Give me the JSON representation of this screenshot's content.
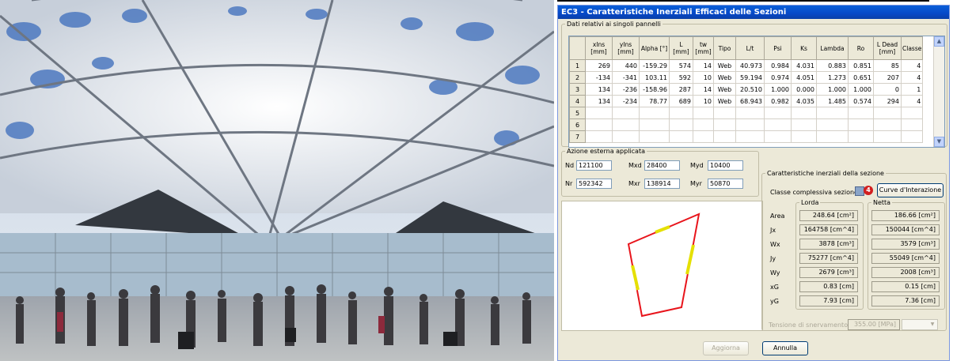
{
  "window": {
    "title": "EC3 - Caratteristiche Inerziali Efficaci delle Sezioni"
  },
  "panels_group": {
    "legend": "Dati relativi ai singoli pannelli",
    "columns": [
      "",
      "xIns [mm]",
      "yIns [mm]",
      "Alpha [°]",
      "L [mm]",
      "tw [mm]",
      "Tipo",
      "L/t",
      "Psi",
      "Ks",
      "Lambda",
      "Ro",
      "L Dead [mm]",
      "Classe"
    ],
    "rows": [
      [
        "1",
        "269",
        "440",
        "-159.29",
        "574",
        "14",
        "Web",
        "40.973",
        "0.984",
        "4.031",
        "0.883",
        "0.851",
        "85",
        "4"
      ],
      [
        "2",
        "-134",
        "-341",
        "103.11",
        "592",
        "10",
        "Web",
        "59.194",
        "0.974",
        "4.051",
        "1.273",
        "0.651",
        "207",
        "4"
      ],
      [
        "3",
        "134",
        "-236",
        "-158.96",
        "287",
        "14",
        "Web",
        "20.510",
        "1.000",
        "0.000",
        "1.000",
        "1.000",
        "0",
        "1"
      ],
      [
        "4",
        "134",
        "-234",
        "78.77",
        "689",
        "10",
        "Web",
        "68.943",
        "0.982",
        "4.035",
        "1.485",
        "0.574",
        "294",
        "4"
      ],
      [
        "5",
        "",
        "",
        "",
        "",
        "",
        "",
        "",
        "",
        "",
        "",
        "",
        "",
        ""
      ],
      [
        "6",
        "",
        "",
        "",
        "",
        "",
        "",
        "",
        "",
        "",
        "",
        "",
        "",
        ""
      ],
      [
        "7",
        "",
        "",
        "",
        "",
        "",
        "",
        "",
        "",
        "",
        "",
        "",
        "",
        ""
      ]
    ]
  },
  "actions_group": {
    "legend": "Azione esterna applicata",
    "Nd": {
      "label": "Nd",
      "value": "121100"
    },
    "Mxd": {
      "label": "Mxd",
      "value": "28400"
    },
    "Myd": {
      "label": "Myd",
      "value": "10400"
    },
    "Nr": {
      "label": "Nr",
      "value": "592342"
    },
    "Mxr": {
      "label": "Mxr",
      "value": "138914"
    },
    "Myr": {
      "label": "Myr",
      "value": "50870"
    }
  },
  "section_group": {
    "legend": "Caratteristiche inerziali della sezione",
    "class_label": "Classe complessiva sezione",
    "class_value": "4",
    "curve_button": "Curve d'Interazione",
    "lorda_legend": "Lorda",
    "netta_legend": "Netta",
    "rows": [
      {
        "label": "Area",
        "lorda": "248.64  [cm²]",
        "netta": "186.66  [cm²]"
      },
      {
        "label": "Jx",
        "lorda": "164758  [cm^4]",
        "netta": "150044  [cm^4]"
      },
      {
        "label": "Wx",
        "lorda": "3878  [cm³]",
        "netta": "3579  [cm³]"
      },
      {
        "label": "Jy",
        "lorda": "75277  [cm^4]",
        "netta": "55049  [cm^4]"
      },
      {
        "label": "Wy",
        "lorda": "2679  [cm³]",
        "netta": "2008  [cm³]"
      },
      {
        "label": "xG",
        "lorda": "0.83  [cm]",
        "netta": "0.15  [cm]"
      },
      {
        "label": "yG",
        "lorda": "7.93  [cm]",
        "netta": "7.36  [cm]"
      }
    ],
    "yield_label": "Tensione di snervamento",
    "yield_value": "355.00  [MPa]"
  },
  "buttons": {
    "apply": "Aggiorna",
    "cancel": "Annulla"
  },
  "colors": {
    "section_outline": "#e8141b",
    "effective_panel": "#e5e000",
    "title_bar": "#0648c8"
  }
}
